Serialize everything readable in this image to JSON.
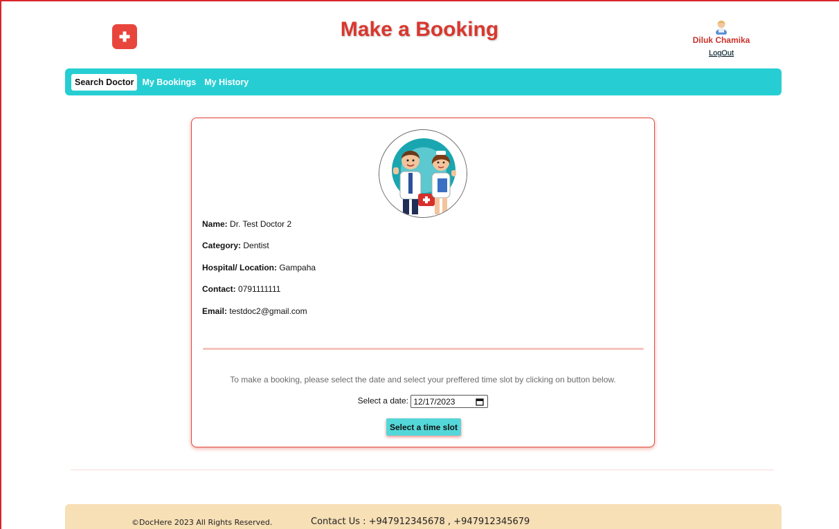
{
  "header": {
    "title": "Make a Booking",
    "user_name": "Diluk Chamika",
    "logout_label": "LogOut"
  },
  "nav": {
    "items": [
      {
        "label": "Search Doctor",
        "active": true
      },
      {
        "label": "My Bookings",
        "active": false
      },
      {
        "label": "My History",
        "active": false
      }
    ]
  },
  "doctor": {
    "name_label": "Name:",
    "name": "Dr. Test Doctor 2",
    "category_label": "Category:",
    "category": "Dentist",
    "location_label": "Hospital/ Location:",
    "location": "Gampaha",
    "contact_label": "Contact:",
    "contact": "0791111111",
    "email_label": "Email:",
    "email": "testdoc2@gmail.com"
  },
  "booking": {
    "instruction": "To make a booking, please select the date and select your preffered time slot by clicking on button below.",
    "date_label": "Select a date:",
    "date_value": "12/17/2023",
    "timeslot_button": "Select a time slot"
  },
  "footer": {
    "copyright": "©DocHere 2023 All Rights Reserved.",
    "contact": "Contact Us : +947912345678 , +947912345679"
  },
  "colors": {
    "brand_red": "#d9372e",
    "nav_teal": "#26ced3",
    "button_teal": "#54d7d9",
    "footer_bg": "#f7dfb6"
  },
  "icons": {
    "logo": "medical-cross-icon",
    "avatar": "user-avatar-icon",
    "calendar": "calendar-icon"
  }
}
